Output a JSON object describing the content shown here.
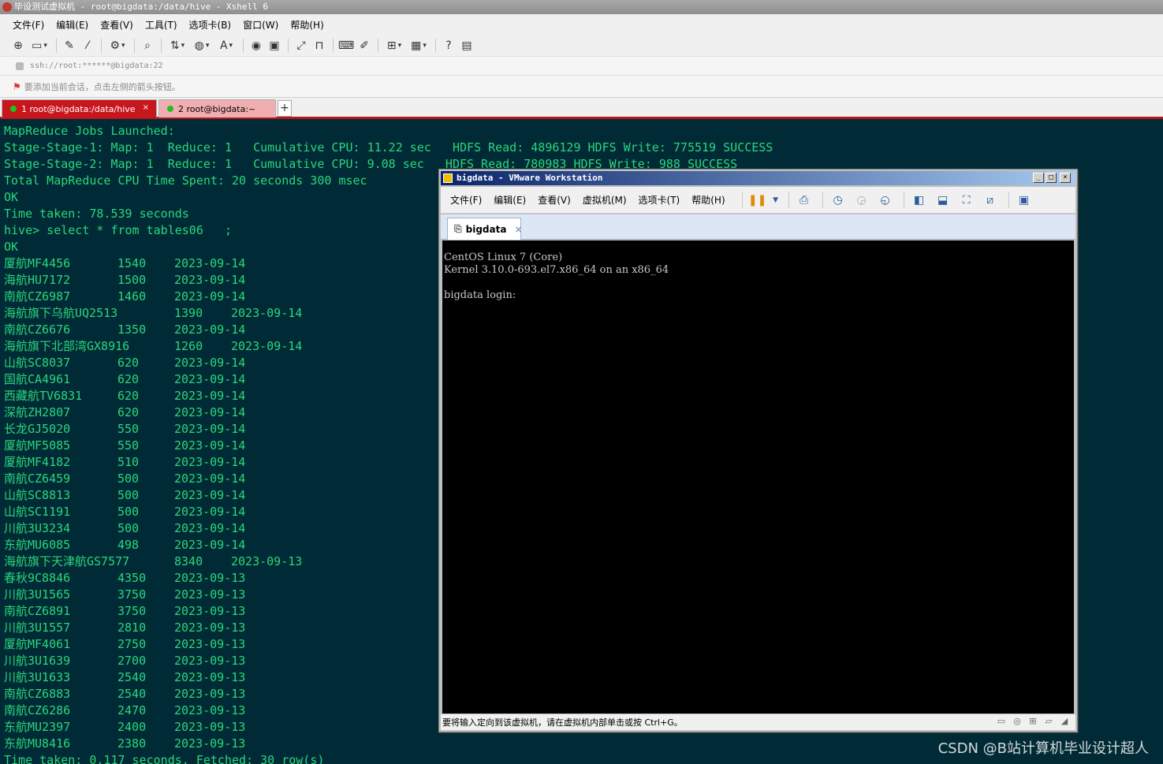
{
  "xshell": {
    "title": "毕设测试虚拟机 - root@bigdata:/data/hive - Xshell 6",
    "menu": [
      "文件(F)",
      "编辑(E)",
      "查看(V)",
      "工具(T)",
      "选项卡(B)",
      "窗口(W)",
      "帮助(H)"
    ],
    "address": "ssh://root:******@bigdata:22",
    "session_hint": "要添加当前会话，点击左侧的箭头按钮。",
    "tabs": [
      {
        "label": "1 root@bigdata:/data/hive",
        "close": "×"
      },
      {
        "label": "2 root@bigdata:~"
      }
    ],
    "add_tab": "+"
  },
  "terminal": {
    "header_lines": [
      "MapReduce Jobs Launched:",
      "Stage-Stage-1: Map: 1  Reduce: 1   Cumulative CPU: 11.22 sec   HDFS Read: 4896129 HDFS Write: 775519 SUCCESS",
      "Stage-Stage-2: Map: 1  Reduce: 1   Cumulative CPU: 9.08 sec   HDFS Read: 780983 HDFS Write: 988 SUCCESS",
      "Total MapReduce CPU Time Spent: 20 seconds 300 msec",
      "OK",
      "Time taken: 78.539 seconds",
      "hive> select * from tables06   ;",
      "OK"
    ],
    "rows": [
      [
        "厦航MF4456",
        "1540",
        "2023-09-14"
      ],
      [
        "海航HU7172",
        "1500",
        "2023-09-14"
      ],
      [
        "南航CZ6987",
        "1460",
        "2023-09-14"
      ],
      [
        "海航旗下乌航UQ2513",
        "1390",
        "2023-09-14"
      ],
      [
        "南航CZ6676",
        "1350",
        "2023-09-14"
      ],
      [
        "海航旗下北部湾GX8916",
        "1260",
        "2023-09-14"
      ],
      [
        "山航SC8037",
        "620",
        "2023-09-14"
      ],
      [
        "国航CA4961",
        "620",
        "2023-09-14"
      ],
      [
        "西藏航TV6831",
        "620",
        "2023-09-14"
      ],
      [
        "深航ZH2807",
        "620",
        "2023-09-14"
      ],
      [
        "长龙GJ5020",
        "550",
        "2023-09-14"
      ],
      [
        "厦航MF5085",
        "550",
        "2023-09-14"
      ],
      [
        "厦航MF4182",
        "510",
        "2023-09-14"
      ],
      [
        "南航CZ6459",
        "500",
        "2023-09-14"
      ],
      [
        "山航SC8813",
        "500",
        "2023-09-14"
      ],
      [
        "山航SC1191",
        "500",
        "2023-09-14"
      ],
      [
        "川航3U3234",
        "500",
        "2023-09-14"
      ],
      [
        "东航MU6085",
        "498",
        "2023-09-14"
      ],
      [
        "海航旗下天津航GS7577",
        "8340",
        "2023-09-13"
      ],
      [
        "春秋9C8846",
        "4350",
        "2023-09-13"
      ],
      [
        "川航3U1565",
        "3750",
        "2023-09-13"
      ],
      [
        "南航CZ6891",
        "3750",
        "2023-09-13"
      ],
      [
        "川航3U1557",
        "2810",
        "2023-09-13"
      ],
      [
        "厦航MF4061",
        "2750",
        "2023-09-13"
      ],
      [
        "川航3U1639",
        "2700",
        "2023-09-13"
      ],
      [
        "川航3U1633",
        "2540",
        "2023-09-13"
      ],
      [
        "南航CZ6883",
        "2540",
        "2023-09-13"
      ],
      [
        "南航CZ6286",
        "2470",
        "2023-09-13"
      ],
      [
        "东航MU2397",
        "2400",
        "2023-09-13"
      ],
      [
        "东航MU8416",
        "2380",
        "2023-09-13"
      ]
    ],
    "footer_line": "Time taken: 0.117 seconds, Fetched: 30 row(s)",
    "text_color": "#2bd67b",
    "background": "#002b36"
  },
  "vmware": {
    "title": "bigdata - VMware Workstation",
    "menu": [
      "文件(F)",
      "编辑(E)",
      "查看(V)",
      "虚拟机(M)",
      "选项卡(T)",
      "帮助(H)"
    ],
    "tab_label": "bigdata",
    "tab_close": "×",
    "console_lines": [
      "CentOS Linux 7 (Core)",
      "Kernel 3.10.0-693.el7.x86_64 on an x86_64",
      "",
      "bigdata login:"
    ],
    "status_text": "要将输入定向到该虚拟机，请在虚拟机内部单击或按 Ctrl+G。"
  },
  "watermark": "CSDN @B站计算机毕业设计超人"
}
